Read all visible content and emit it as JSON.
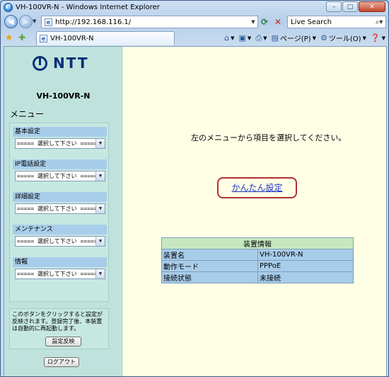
{
  "window": {
    "title": "VH-100VR-N - Windows Internet Explorer",
    "minimize": "–",
    "maximize": "□",
    "close": "✕"
  },
  "addressbar": {
    "url": "http://192.168.116.1/",
    "search_placeholder": "Live Search"
  },
  "tab": {
    "title": "VH-100VR-N"
  },
  "commandbar": {
    "page": "ページ(P)",
    "tools": "ツール(O)"
  },
  "sidebar": {
    "brand": "NTT",
    "model": "VH-100VR-N",
    "menu_title": "メニュー",
    "groups": [
      {
        "label": "基本設定",
        "selected": "===== 選択して下さい ====="
      },
      {
        "label": "IP電話設定",
        "selected": "===== 選択して下さい ====="
      },
      {
        "label": "詳細設定",
        "selected": "===== 選択して下さい ====="
      },
      {
        "label": "メンテナンス",
        "selected": "===== 選択して下さい ====="
      },
      {
        "label": "情報",
        "selected": "===== 選択して下さい ====="
      }
    ],
    "apply_note": "このボタンをクリックすると設定が反映されます。登録完了後、本装置は自動的に再起動します。",
    "apply_button": "設定反映",
    "logout_button": "ログアウト"
  },
  "main": {
    "message": "左のメニューから項目を選択してください。",
    "easy_setup": "かんたん設定",
    "device_info": {
      "header": "装置情報",
      "rows": [
        {
          "label": "装置名",
          "value": "VH-100VR-N"
        },
        {
          "label": "動作モード",
          "value": "PPPoE"
        },
        {
          "label": "接続状態",
          "value": "未接続"
        }
      ]
    }
  }
}
